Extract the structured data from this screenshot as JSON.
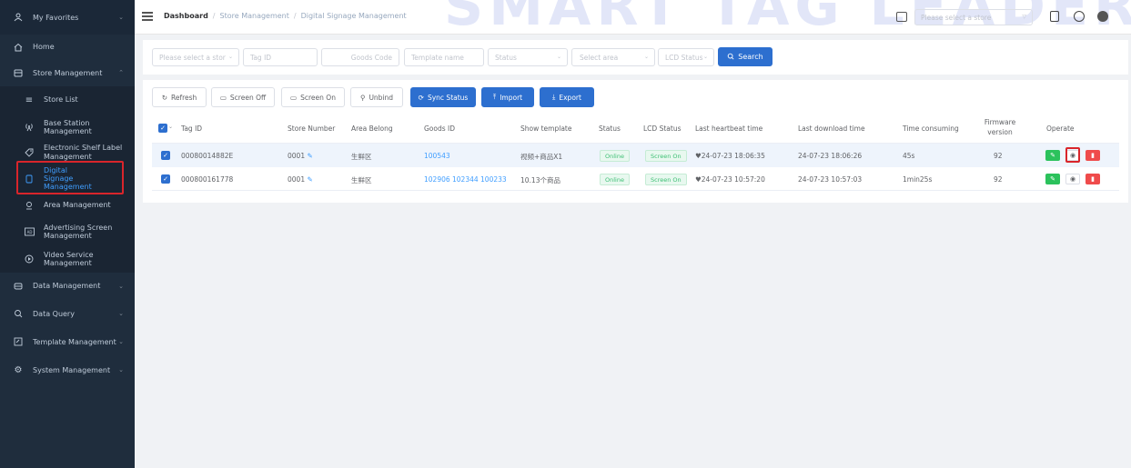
{
  "watermark": "SMART TAG LEADER",
  "sidebar": {
    "favorites": "My Favorites",
    "home": "Home",
    "store_management": "Store Management",
    "sub_items": [
      {
        "label": "Store List"
      },
      {
        "label": "Base Station Management"
      },
      {
        "label": "Electronic Shelf Label Management"
      },
      {
        "label": "Digital Signage Management"
      },
      {
        "label": "Area Management"
      },
      {
        "label": "Advertising Screen Management"
      },
      {
        "label": "Video Service Management"
      }
    ],
    "groups": [
      {
        "label": "Data Management"
      },
      {
        "label": "Data Query"
      },
      {
        "label": "Template Management"
      },
      {
        "label": "System Management"
      }
    ]
  },
  "breadcrumb": {
    "root": "Dashboard",
    "level1": "Store Management",
    "level2": "Digital Signage Management"
  },
  "header": {
    "store_placeholder": "Please select a store"
  },
  "filters": {
    "store_placeholder": "Please select a stor",
    "tag_id_placeholder": "Tag ID",
    "goods_code_placeholder": "Goods Code",
    "template_placeholder": "Template name",
    "status_placeholder": "Status",
    "area_placeholder": "Select area",
    "lcd_placeholder": "LCD Status",
    "search_label": "Search"
  },
  "toolbar": {
    "refresh": "Refresh",
    "screen_off": "Screen Off",
    "screen_on": "Screen On",
    "unbind": "Unbind",
    "sync_status": "Sync Status",
    "import": "Import",
    "export": "Export"
  },
  "table": {
    "columns": {
      "tag_id": "Tag ID",
      "store_number": "Store Number",
      "area": "Area Belong",
      "goods_id": "Goods ID",
      "template": "Show template",
      "status": "Status",
      "lcd": "LCD Status",
      "heartbeat": "Last heartbeat time",
      "download": "Last download time",
      "time": "Time consuming",
      "firmware": "Firmware version",
      "operate": "Operate"
    },
    "rows": [
      {
        "tag_id": "00080014882E",
        "store_number": "0001",
        "area": "生鲜区",
        "goods_id": "100543",
        "template": "视频+商品X1",
        "status": "Online",
        "lcd": "Screen On",
        "heartbeat": "24-07-23 18:06:35",
        "download": "24-07-23 18:06:26",
        "time": "45s",
        "firmware": "92"
      },
      {
        "tag_id": "000800161778",
        "store_number": "0001",
        "area": "生鲜区",
        "goods_id": "102906 102344 100233",
        "template": "10.13个商品",
        "status": "Online",
        "lcd": "Screen On",
        "heartbeat": "24-07-23 10:57:20",
        "download": "24-07-23 10:57:03",
        "time": "1min25s",
        "firmware": "92"
      }
    ]
  }
}
